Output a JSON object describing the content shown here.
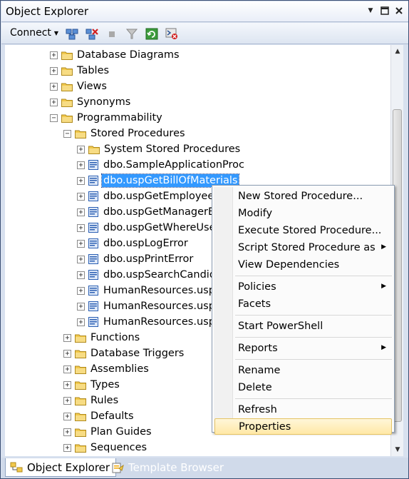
{
  "window": {
    "title": "Object Explorer",
    "buttons": {
      "dropdown": "▼",
      "maximize": "□",
      "close": "✕"
    }
  },
  "toolbar": {
    "connect_label": "Connect",
    "connect_caret": "▼",
    "icons": [
      "connect-object-explorer-icon",
      "disconnect-icon",
      "stop-icon",
      "filter-icon",
      "refresh-icon",
      "start-powershell-icon"
    ]
  },
  "tree": {
    "nodes": [
      {
        "label": "Database Diagrams",
        "level": 0,
        "expander": "+",
        "kind": "folder"
      },
      {
        "label": "Tables",
        "level": 0,
        "expander": "+",
        "kind": "folder"
      },
      {
        "label": "Views",
        "level": 0,
        "expander": "+",
        "kind": "folder"
      },
      {
        "label": "Synonyms",
        "level": 0,
        "expander": "+",
        "kind": "folder"
      },
      {
        "label": "Programmability",
        "level": 0,
        "expander": "−",
        "kind": "folder"
      },
      {
        "label": "Stored Procedures",
        "level": 1,
        "expander": "−",
        "kind": "folder"
      },
      {
        "label": "System Stored Procedures",
        "level": 2,
        "expander": "+",
        "kind": "folder"
      },
      {
        "label": "dbo.SampleApplicationProc",
        "level": 2,
        "expander": "+",
        "kind": "proc"
      },
      {
        "label": "dbo.uspGetBillOfMaterials",
        "level": 2,
        "expander": "+",
        "kind": "proc",
        "selected": true
      },
      {
        "label": "dbo.uspGetEmployeeM",
        "level": 2,
        "expander": "+",
        "kind": "proc"
      },
      {
        "label": "dbo.uspGetManagerEm",
        "level": 2,
        "expander": "+",
        "kind": "proc"
      },
      {
        "label": "dbo.uspGetWhereUsed",
        "level": 2,
        "expander": "+",
        "kind": "proc"
      },
      {
        "label": "dbo.uspLogError",
        "level": 2,
        "expander": "+",
        "kind": "proc"
      },
      {
        "label": "dbo.uspPrintError",
        "level": 2,
        "expander": "+",
        "kind": "proc"
      },
      {
        "label": "dbo.uspSearchCandida",
        "level": 2,
        "expander": "+",
        "kind": "proc"
      },
      {
        "label": "HumanResources.uspU",
        "level": 2,
        "expander": "+",
        "kind": "proc"
      },
      {
        "label": "HumanResources.uspU",
        "level": 2,
        "expander": "+",
        "kind": "proc"
      },
      {
        "label": "HumanResources.uspU",
        "level": 2,
        "expander": "+",
        "kind": "proc"
      },
      {
        "label": "Functions",
        "level": 1,
        "expander": "+",
        "kind": "folder"
      },
      {
        "label": "Database Triggers",
        "level": 1,
        "expander": "+",
        "kind": "folder"
      },
      {
        "label": "Assemblies",
        "level": 1,
        "expander": "+",
        "kind": "folder"
      },
      {
        "label": "Types",
        "level": 1,
        "expander": "+",
        "kind": "folder"
      },
      {
        "label": "Rules",
        "level": 1,
        "expander": "+",
        "kind": "folder"
      },
      {
        "label": "Defaults",
        "level": 1,
        "expander": "+",
        "kind": "folder"
      },
      {
        "label": "Plan Guides",
        "level": 1,
        "expander": "+",
        "kind": "folder"
      },
      {
        "label": "Sequences",
        "level": 1,
        "expander": "+",
        "kind": "folder"
      }
    ]
  },
  "context_menu": {
    "items": [
      {
        "label": "New Stored Procedure...",
        "submenu": false
      },
      {
        "label": "Modify",
        "submenu": false
      },
      {
        "label": "Execute Stored Procedure...",
        "submenu": false
      },
      {
        "label": "Script Stored Procedure as",
        "submenu": true
      },
      {
        "label": "View Dependencies",
        "submenu": false
      },
      {
        "separator": true
      },
      {
        "label": "Policies",
        "submenu": true
      },
      {
        "label": "Facets",
        "submenu": false
      },
      {
        "separator": true
      },
      {
        "label": "Start PowerShell",
        "submenu": false
      },
      {
        "separator": true
      },
      {
        "label": "Reports",
        "submenu": true
      },
      {
        "separator": true
      },
      {
        "label": "Rename",
        "submenu": false
      },
      {
        "label": "Delete",
        "submenu": false
      },
      {
        "separator": true
      },
      {
        "label": "Refresh",
        "submenu": false
      },
      {
        "label": "Properties",
        "submenu": false,
        "hot": true
      }
    ],
    "submenu_arrow": "▶"
  },
  "scrollbar": {
    "up": "▲",
    "down": "▼"
  },
  "tabs": [
    {
      "label": "Object Explorer",
      "active": true,
      "icon": "object-explorer-icon"
    },
    {
      "label": "Template Browser",
      "active": false,
      "icon": "template-browser-icon"
    }
  ],
  "colors": {
    "selection": "#3399ff",
    "folder": "#f2c94c",
    "menu_highlight": "#ffe8a6",
    "frame": "#d8e1ef"
  }
}
